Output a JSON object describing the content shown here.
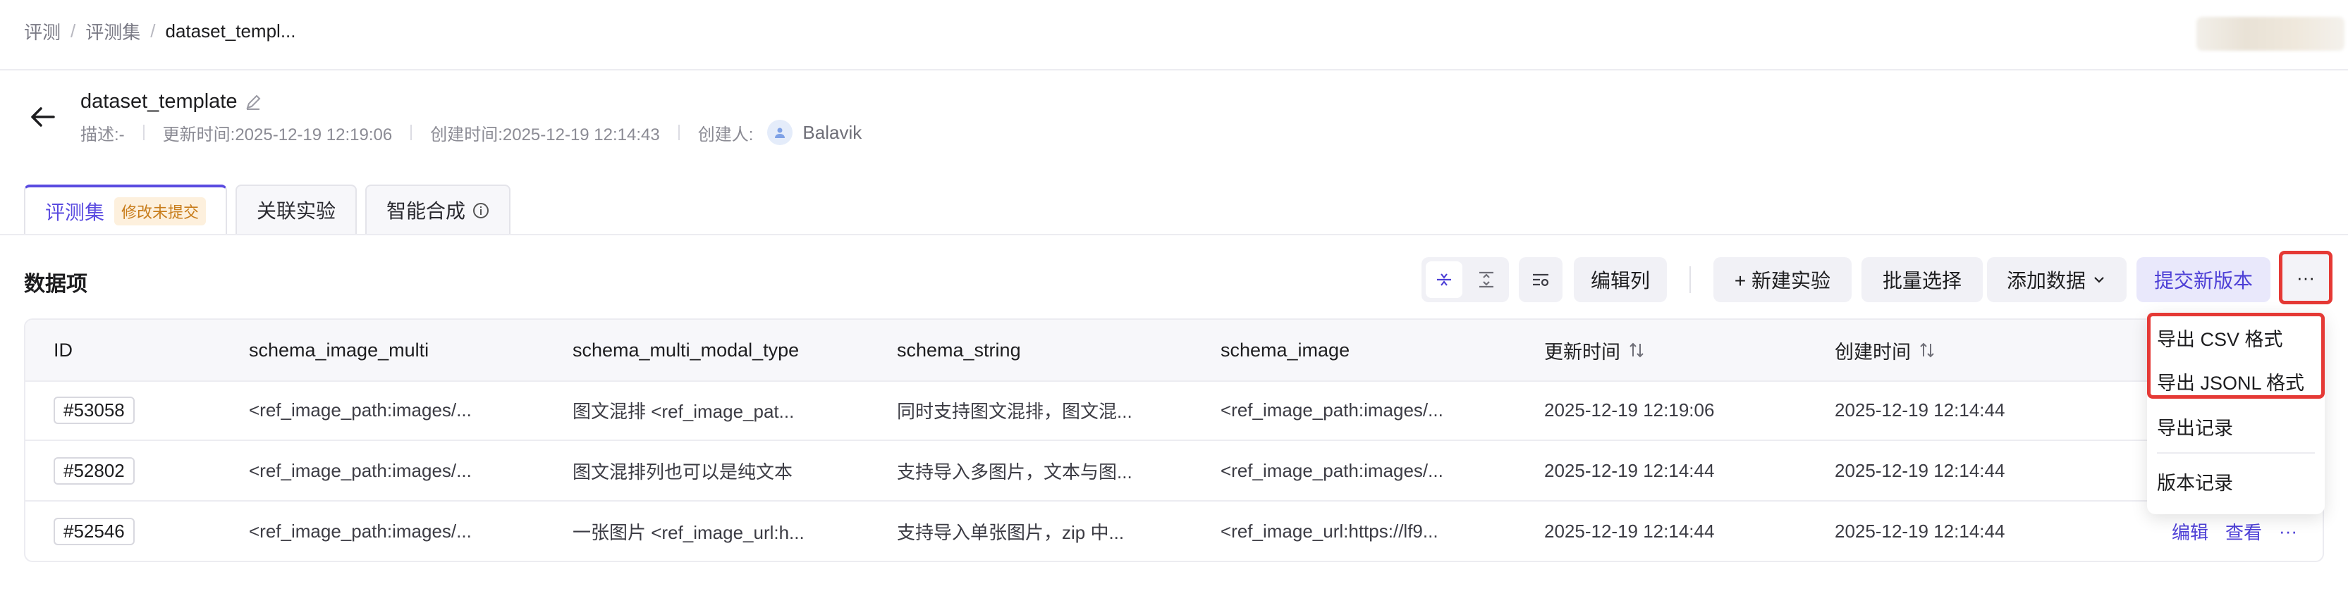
{
  "breadcrumb": [
    "评测",
    "评测集",
    "dataset_templ..."
  ],
  "breadcrumb_sep": "/",
  "header": {
    "title": "dataset_template",
    "description": "描述:-",
    "updated": "更新时间:2025-12-19 12:19:06",
    "created": "创建时间:2025-12-19 12:14:43",
    "creator_label": "创建人:",
    "creator": "Balavik"
  },
  "tabs": [
    {
      "label": "评测集",
      "badge": "修改未提交",
      "active": true
    },
    {
      "label": "关联实验"
    },
    {
      "label": "智能合成",
      "icon": "info-icon"
    }
  ],
  "toolbar": {
    "section_title": "数据项",
    "edit_columns": "编辑列",
    "new_experiment": "+ 新建实验",
    "batch_select": "批量选择",
    "add_data": "添加数据",
    "submit_version": "提交新版本",
    "more": "···"
  },
  "table": {
    "columns": [
      "ID",
      "schema_image_multi",
      "schema_multi_modal_type",
      "schema_string",
      "schema_image",
      "更新时间",
      "创建时间"
    ],
    "rows": [
      {
        "id": "#53058",
        "c1": "<ref_image_path:images/...",
        "c2": "图文混排 <ref_image_pat...",
        "c3": "同时支持图文混排，图文混...",
        "c4": "<ref_image_path:images/...",
        "updated": "2025-12-19 12:19:06",
        "created": "2025-12-19 12:14:44"
      },
      {
        "id": "#52802",
        "c1": "<ref_image_path:images/...",
        "c2": "图文混排列也可以是纯文本",
        "c3": "支持导入多图片，文本与图...",
        "c4": "<ref_image_path:images/...",
        "updated": "2025-12-19 12:14:44",
        "created": "2025-12-19 12:14:44"
      },
      {
        "id": "#52546",
        "c1": "<ref_image_path:images/...",
        "c2": "一张图片 <ref_image_url:h...",
        "c3": "支持导入单张图片，zip 中...",
        "c4": "<ref_image_url:https://lf9...",
        "updated": "2025-12-19 12:14:44",
        "created": "2025-12-19 12:14:44"
      }
    ],
    "row_actions": {
      "edit": "编辑",
      "view": "查看",
      "more": "···"
    }
  },
  "dropdown": {
    "items": [
      "导出 CSV 格式",
      "导出 JSONL 格式",
      "导出记录",
      "版本记录"
    ]
  },
  "colors": {
    "accent": "#5a4be0",
    "highlight": "#e53935",
    "badge_bg": "#fdf0dd",
    "badge_text": "#c87c1a"
  }
}
